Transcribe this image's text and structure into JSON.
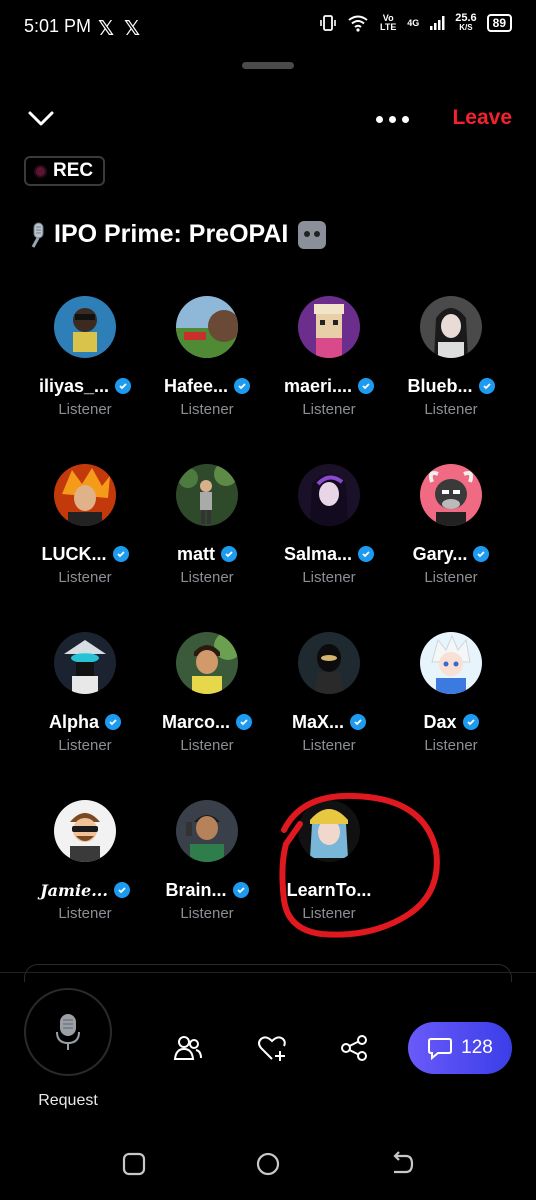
{
  "status_bar": {
    "time": "5:01 PM",
    "network_speed_value": "25.6",
    "network_speed_unit": "K/S",
    "volte": "Vo LTE",
    "signal": "4G",
    "battery": "89"
  },
  "header": {
    "leave_label": "Leave",
    "rec_label": "REC",
    "accent_color": "#f4212e"
  },
  "space": {
    "title": "IPO Prime: PreOPAI",
    "title_prefix_icon": "microphone-emoji",
    "title_suffix_icon": "robot-emoji"
  },
  "participants": [
    {
      "name": "iliyas_...",
      "role": "Listener",
      "verified": true
    },
    {
      "name": "Hafee...",
      "role": "Listener",
      "verified": true
    },
    {
      "name": "maeri....",
      "role": "Listener",
      "verified": true
    },
    {
      "name": "Blueb...",
      "role": "Listener",
      "verified": true
    },
    {
      "name": "LUCK...",
      "role": "Listener",
      "verified": true
    },
    {
      "name": "matt",
      "role": "Listener",
      "verified": true
    },
    {
      "name": "Salma...",
      "role": "Listener",
      "verified": true
    },
    {
      "name": "Gary...",
      "role": "Listener",
      "verified": true
    },
    {
      "name": "Alpha",
      "role": "Listener",
      "verified": true
    },
    {
      "name": "Marco...",
      "role": "Listener",
      "verified": true
    },
    {
      "name": "MaX...",
      "role": "Listener",
      "verified": true
    },
    {
      "name": "Dax",
      "role": "Listener",
      "verified": true
    },
    {
      "name": "Jamie...",
      "role": "Listener",
      "verified": true
    },
    {
      "name": "Brain...",
      "role": "Listener",
      "verified": true
    },
    {
      "name": "LearnTo...",
      "role": "Listener",
      "verified": false
    }
  ],
  "bottom_bar": {
    "request_label": "Request",
    "chat_count": "128",
    "chat_color": "#5b4ef5"
  }
}
